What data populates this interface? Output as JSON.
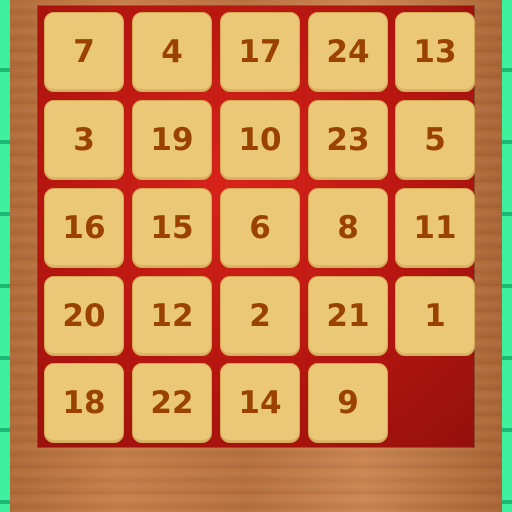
{
  "puzzle": {
    "tiles": [
      {
        "label": "7"
      },
      {
        "label": "4"
      },
      {
        "label": "17"
      },
      {
        "label": "24"
      },
      {
        "label": "13"
      },
      {
        "label": "3"
      },
      {
        "label": "19"
      },
      {
        "label": "10"
      },
      {
        "label": "23"
      },
      {
        "label": "5"
      },
      {
        "label": "16"
      },
      {
        "label": "15"
      },
      {
        "label": "6"
      },
      {
        "label": "8"
      },
      {
        "label": "11"
      },
      {
        "label": "20"
      },
      {
        "label": "12"
      },
      {
        "label": "2"
      },
      {
        "label": "21"
      },
      {
        "label": "1"
      },
      {
        "label": "18"
      },
      {
        "label": "22"
      },
      {
        "label": "14"
      },
      {
        "label": "9"
      }
    ]
  },
  "colors": {
    "board_red": "#b4160f",
    "tile_tan": "#ebc878",
    "tile_text": "#9a4300",
    "side_green": "#2fe08f"
  }
}
